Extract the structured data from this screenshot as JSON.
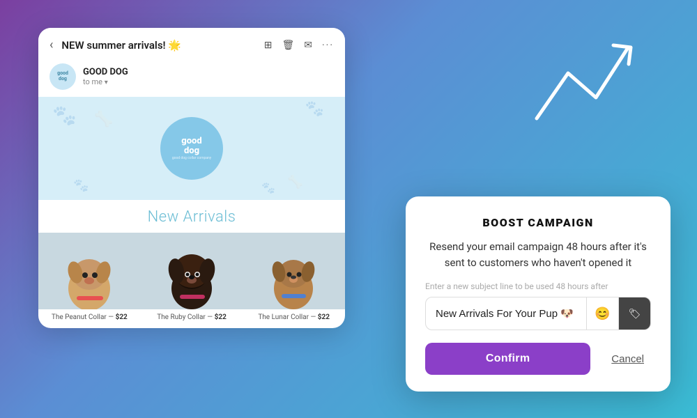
{
  "background": {
    "gradient_start": "#7B3FA0",
    "gradient_end": "#3ABCD4"
  },
  "email_card": {
    "subject": "NEW summer arrivals! 🌟",
    "sender_name": "GOOD DOG",
    "sender_to": "to me",
    "back_arrow": "‹",
    "actions": [
      "⊞",
      "🗑",
      "✉",
      "···"
    ],
    "banner_brand": "good\ndog",
    "new_arrivals_title": "New Arrivals",
    "products": [
      {
        "name": "The Peanut Collar",
        "price": "$22",
        "color": "#d4a76a"
      },
      {
        "name": "The Ruby Collar",
        "price": "$22",
        "color": "#3a2a1a"
      },
      {
        "name": "The Lunar Collar",
        "price": "$22",
        "color": "#b8834a"
      }
    ]
  },
  "boost_modal": {
    "title": "BOOST CAMPAIGN",
    "description": "Resend your email campaign 48 hours after it's sent to customers who haven't opened it",
    "sublabel": "Enter a new subject line to be used 48 hours after",
    "input_value": "New Arrivals For Your Pup 🐶",
    "input_placeholder": "New Arrivals For Your Pup 🐶",
    "emoji_icon": "😊",
    "tag_icon": "🏷",
    "confirm_label": "Confirm",
    "cancel_label": "Cancel",
    "confirm_color": "#8B3FC8"
  }
}
